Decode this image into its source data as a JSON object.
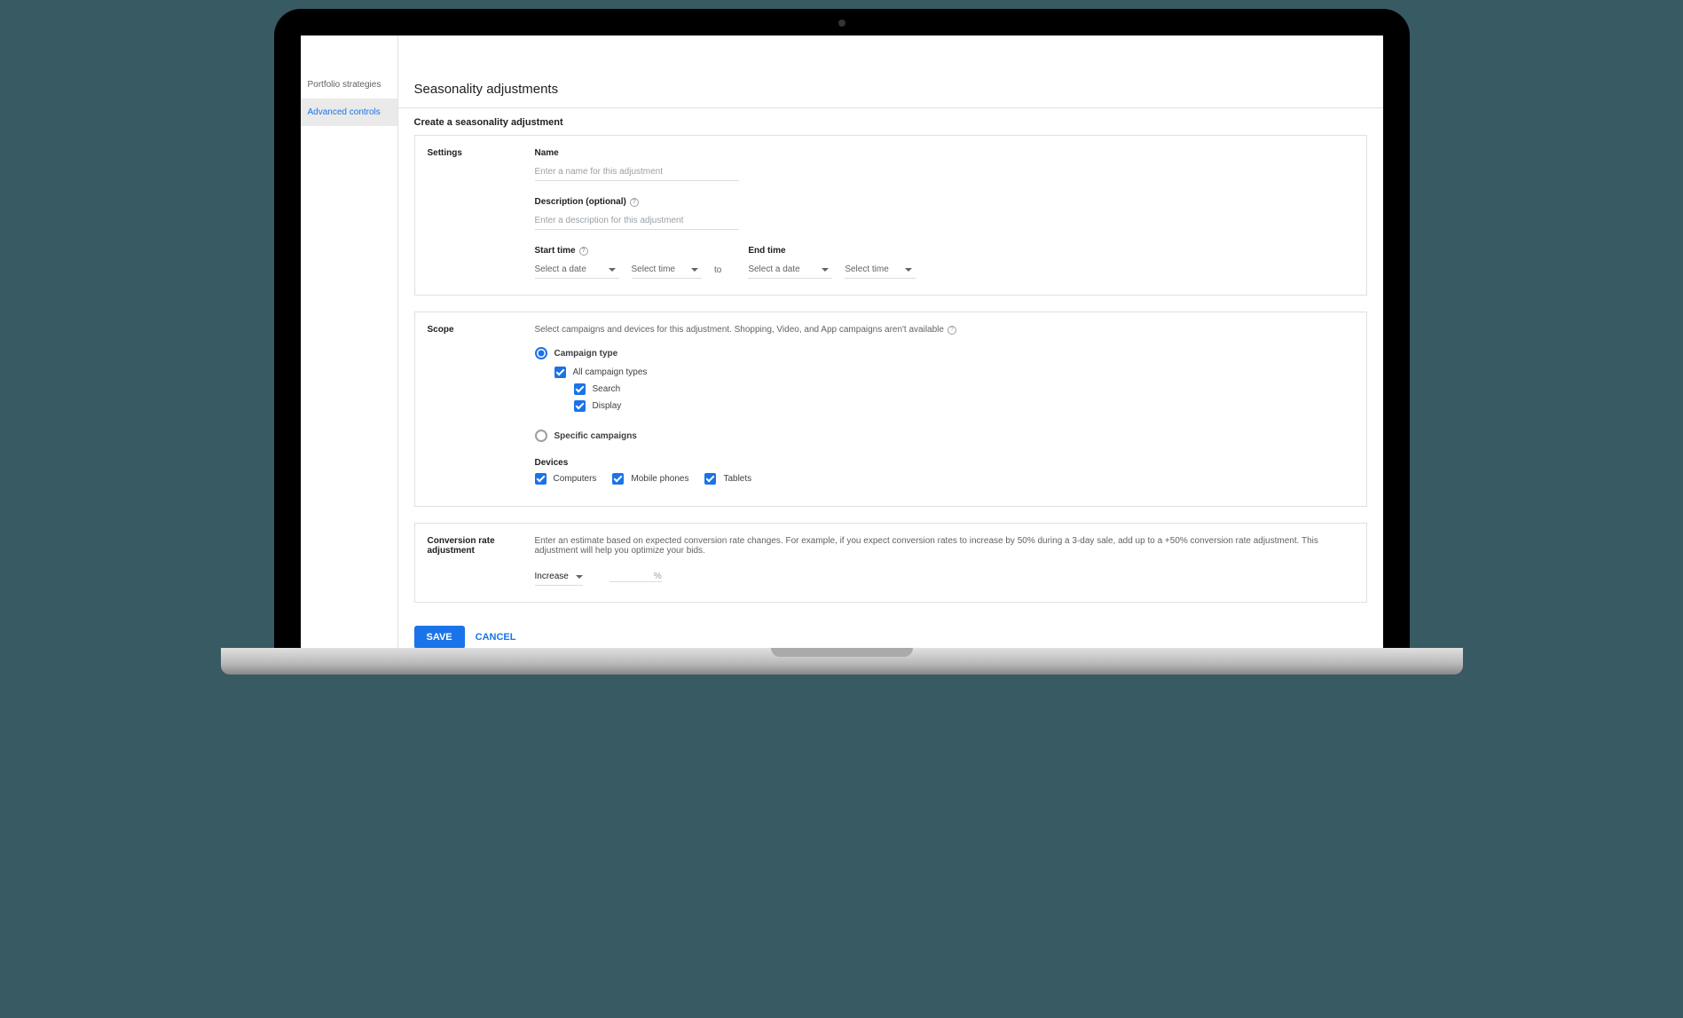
{
  "sidebar": {
    "items": [
      {
        "label": "Portfolio strategies"
      },
      {
        "label": "Advanced controls"
      }
    ]
  },
  "page": {
    "title": "Seasonality adjustments",
    "subtitle": "Create a seasonality adjustment"
  },
  "settings": {
    "section_label": "Settings",
    "name_label": "Name",
    "name_placeholder": "Enter a name for this adjustment",
    "desc_label": "Description (optional)",
    "desc_placeholder": "Enter a description for this adjustment",
    "start_label": "Start time",
    "end_label": "End time",
    "date_placeholder": "Select a date",
    "time_placeholder": "Select time",
    "to_label": "to"
  },
  "scope": {
    "section_label": "Scope",
    "helper": "Select campaigns and devices for this adjustment. Shopping, Video, and App campaigns aren't available",
    "campaign_type_label": "Campaign type",
    "all_types_label": "All campaign types",
    "search_label": "Search",
    "display_label": "Display",
    "specific_label": "Specific campaigns",
    "devices_label": "Devices",
    "computers_label": "Computers",
    "mobile_label": "Mobile phones",
    "tablets_label": "Tablets"
  },
  "rate": {
    "section_label": "Conversion rate adjustment",
    "helper": "Enter an estimate based on expected conversion rate changes. For example, if you expect conversion rates to increase by 50% during a 3-day sale, add up to a +50% conversion rate adjustment. This adjustment will help you optimize your bids.",
    "direction": "Increase",
    "pct_symbol": "%"
  },
  "actions": {
    "save": "SAVE",
    "cancel": "CANCEL"
  }
}
